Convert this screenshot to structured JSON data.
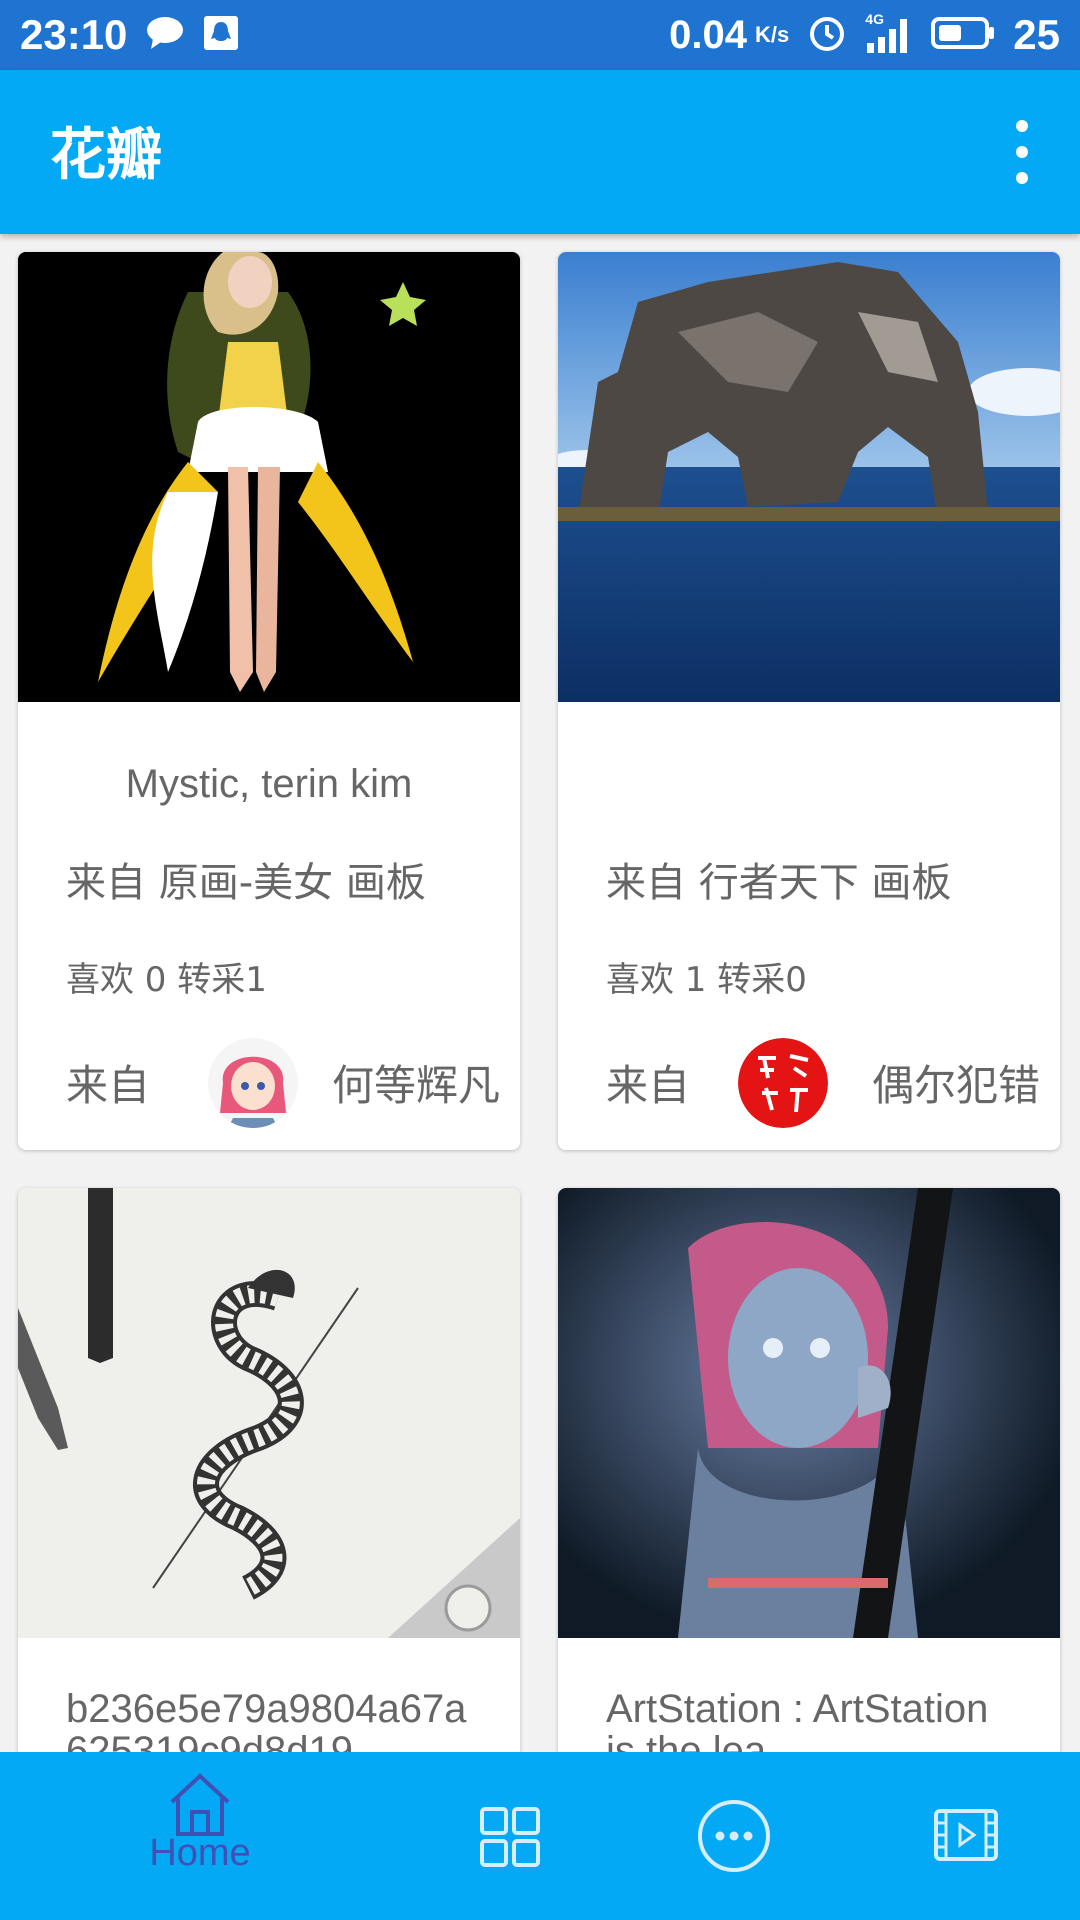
{
  "status_bar": {
    "time": "23:10",
    "net_speed": "0.04",
    "net_unit": "K/s",
    "network": "4G",
    "battery": "25"
  },
  "app_bar": {
    "title": "花瓣"
  },
  "cards": [
    {
      "title": "Mystic, terin kim",
      "board": "来自 原画-美女 画板",
      "stats": "喜欢 0 转采1",
      "from_label": "来自",
      "user": "何等辉凡"
    },
    {
      "title": "",
      "board": "来自 行者天下 画板",
      "stats": "喜欢 1 转采0",
      "from_label": "来自",
      "user": "偶尔犯错"
    },
    {
      "title": "b236e5e79a9804a67a625319c9d8d19"
    },
    {
      "title": "ArtStation : ArtStation is the lea"
    }
  ],
  "bottom_nav": {
    "items": [
      {
        "label": "Home",
        "icon": "home-icon",
        "active": true
      },
      {
        "label": "",
        "icon": "grid-icon"
      },
      {
        "label": "",
        "icon": "more-circle-icon"
      },
      {
        "label": "",
        "icon": "video-icon"
      }
    ],
    "active_color": "#3f51b5",
    "inactive_color": "#d6eefc"
  },
  "colors": {
    "status_bar": "#1f73d1",
    "primary": "#03a9f4",
    "background": "#f2f2f2"
  }
}
